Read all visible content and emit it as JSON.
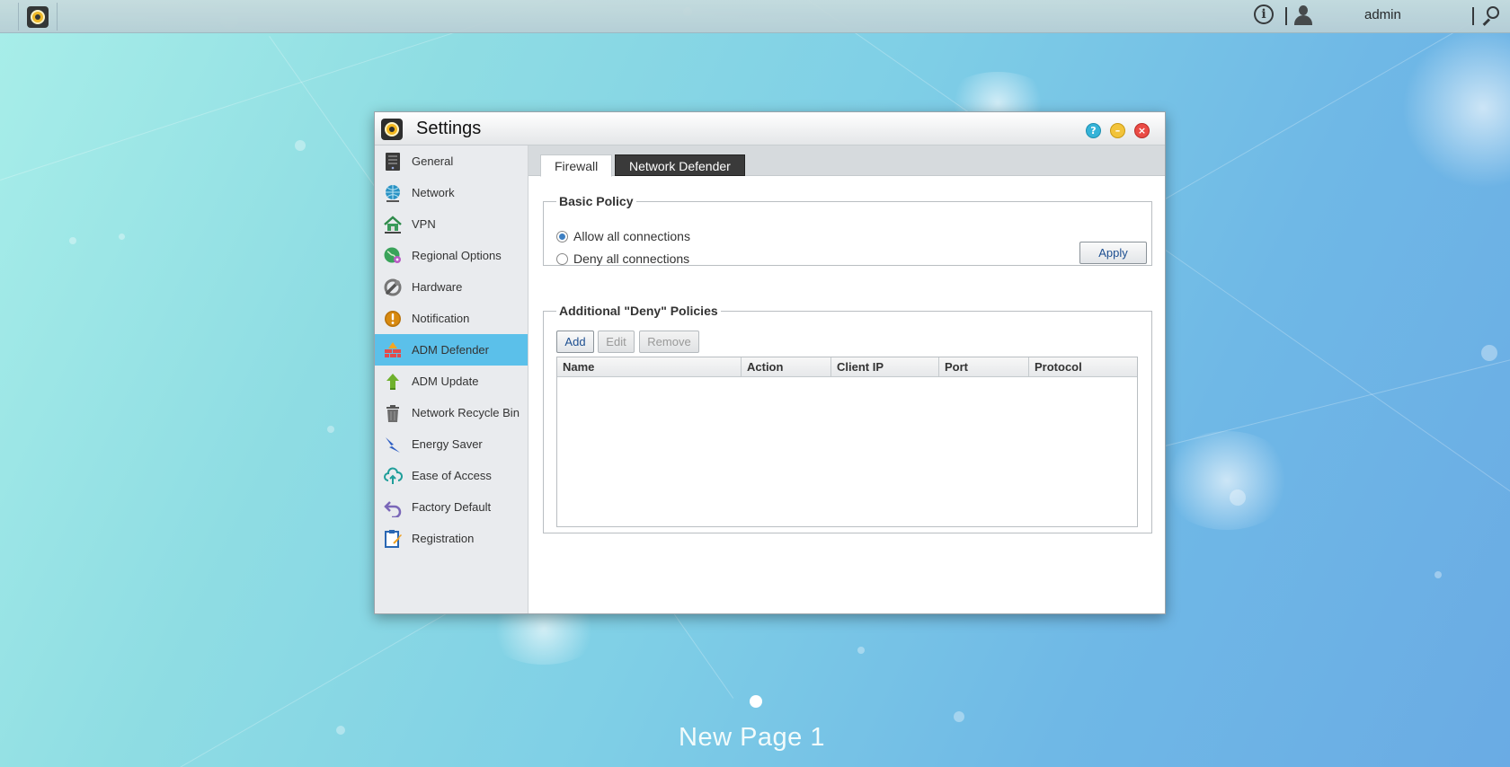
{
  "topbar": {
    "username": "admin"
  },
  "window": {
    "title": "Settings",
    "help_symbol": "?",
    "minimize_symbol": "–",
    "close_symbol": "×"
  },
  "sidebar": {
    "items": [
      {
        "label": "General",
        "icon": "nas-device-icon"
      },
      {
        "label": "Network",
        "icon": "globe-icon"
      },
      {
        "label": "VPN",
        "icon": "vpn-house-icon"
      },
      {
        "label": "Regional Options",
        "icon": "regional-globe-icon"
      },
      {
        "label": "Hardware",
        "icon": "hardware-wrench-icon"
      },
      {
        "label": "Notification",
        "icon": "exclamation-icon"
      },
      {
        "label": "ADM Defender",
        "icon": "firewall-brick-icon",
        "active": true
      },
      {
        "label": "ADM Update",
        "icon": "update-arrow-icon"
      },
      {
        "label": "Network Recycle Bin",
        "icon": "recycle-bin-icon"
      },
      {
        "label": "Energy Saver",
        "icon": "lightning-icon"
      },
      {
        "label": "Ease of Access",
        "icon": "cloud-upload-icon"
      },
      {
        "label": "Factory Default",
        "icon": "undo-arrow-icon"
      },
      {
        "label": "Registration",
        "icon": "registration-doc-icon"
      }
    ]
  },
  "tabs": {
    "firewall": "Firewall",
    "network_defender": "Network Defender"
  },
  "basic_policy": {
    "legend": "Basic Policy",
    "options": [
      {
        "label": "Allow all connections",
        "selected": true
      },
      {
        "label": "Deny all connections",
        "selected": false
      }
    ],
    "apply_label": "Apply"
  },
  "deny_policies": {
    "legend": "Additional \"Deny\" Policies",
    "add_label": "Add",
    "edit_label": "Edit",
    "remove_label": "Remove",
    "columns": [
      "Name",
      "Action",
      "Client IP",
      "Port",
      "Protocol"
    ],
    "rows": []
  },
  "desktop": {
    "page_name": "New Page 1"
  },
  "colors": {
    "accent_active": "#5bc0ea",
    "tab_dark": "#3a3a3a",
    "button_text": "#1d4f91"
  }
}
